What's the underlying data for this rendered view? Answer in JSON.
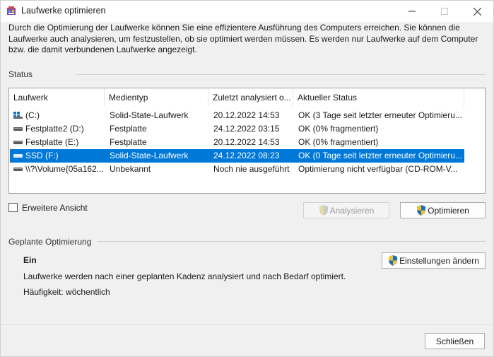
{
  "window": {
    "title": "Laufwerke optimieren"
  },
  "description": "Durch die Optimierung der Laufwerke können Sie eine effizientere Ausführung des Computers erreichen. Sie können die Laufwerke auch analysieren, um festzustellen, ob sie optimiert werden müssen. Es werden nur Laufwerke auf dem Computer bzw. die damit verbundenen Laufwerke angezeigt.",
  "status_group": {
    "label": "Status"
  },
  "drives_table": {
    "columns": [
      "Laufwerk",
      "Medientyp",
      "Zuletzt analysiert o...",
      "Aktueller Status"
    ],
    "rows": [
      {
        "drive": "(C:)",
        "media": "Solid-State-Laufwerk",
        "last": "20.12.2022 14:53",
        "status": "OK (3 Tage seit letzter erneuter Optimieru...",
        "icon": "windows-drive-icon",
        "selected": false
      },
      {
        "drive": "Festplatte2 (D:)",
        "media": "Festplatte",
        "last": "24.12.2022 03:15",
        "status": "OK (0% fragmentiert)",
        "icon": "hard-drive-icon",
        "selected": false
      },
      {
        "drive": "Festplatte (E:)",
        "media": "Festplatte",
        "last": "20.12.2022 14:53",
        "status": "OK (0% fragmentiert)",
        "icon": "hard-drive-icon",
        "selected": false
      },
      {
        "drive": "SSD (F:)",
        "media": "Solid-State-Laufwerk",
        "last": "24.12.2022 08:23",
        "status": "OK (0 Tage seit letzter erneuter Optimieru...",
        "icon": "hard-drive-icon",
        "selected": true
      },
      {
        "drive": "\\\\?\\Volume{05a162...",
        "media": "Unbekannt",
        "last": "Noch nie ausgeführt",
        "status": "Optimierung nicht verfügbar (CD-ROM-V...",
        "icon": "hard-drive-icon",
        "selected": false
      }
    ]
  },
  "advanced_view": {
    "label": "Erweitere Ansicht",
    "checked": false
  },
  "buttons": {
    "analyze": "Analysieren",
    "optimize": "Optimieren",
    "change_settings": "Einstellungen ändern",
    "close": "Schließen"
  },
  "schedule": {
    "label": "Geplante Optimierung",
    "status": "Ein",
    "description": "Laufwerke werden nach einer geplanten Kadenz analysiert und nach Bedarf optimiert.",
    "frequency": "Häufigkeit: wöchentlich"
  },
  "colors": {
    "selection": "#0078d7",
    "drive_blue": "#1b6fc2"
  }
}
